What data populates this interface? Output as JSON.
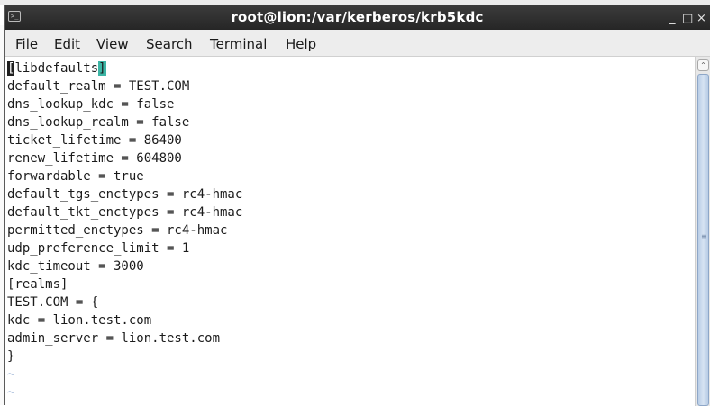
{
  "window": {
    "title": "root@lion:/var/kerberos/krb5kdc",
    "minimize_glyph": "_",
    "maximize_glyph": "□",
    "close_glyph": "×",
    "icon": "terminal-icon"
  },
  "menu": {
    "items": [
      "File",
      "Edit",
      "View",
      "Search",
      "Terminal",
      "Help"
    ]
  },
  "editor": {
    "first_line": {
      "cursor_char": "[",
      "text": "libdefaults",
      "matched_bracket": "]"
    },
    "lines": [
      "default_realm = TEST.COM",
      "dns_lookup_kdc = false",
      "dns_lookup_realm = false",
      "ticket_lifetime = 86400",
      "renew_lifetime = 604800",
      "forwardable = true",
      "default_tgs_enctypes = rc4-hmac",
      "default_tkt_enctypes = rc4-hmac",
      "permitted_enctypes = rc4-hmac",
      "udp_preference_limit = 1",
      "kdc_timeout = 3000",
      "[realms]",
      "TEST.COM = {",
      "kdc = lion.test.com",
      "admin_server = lion.test.com",
      "}"
    ],
    "empty_line_markers": [
      "~",
      "~"
    ]
  },
  "scrollbar": {
    "up_arrow_glyph": "⌃",
    "grip_glyph": "≡"
  },
  "colors": {
    "titlebar": "#2f2f2f",
    "menubar": "#ededed",
    "cursor": "#1f1f1f",
    "bracket_highlight": "#3cb5a5",
    "tilde": "#6a8ec0",
    "scroll_thumb": "#c6d7ec"
  }
}
